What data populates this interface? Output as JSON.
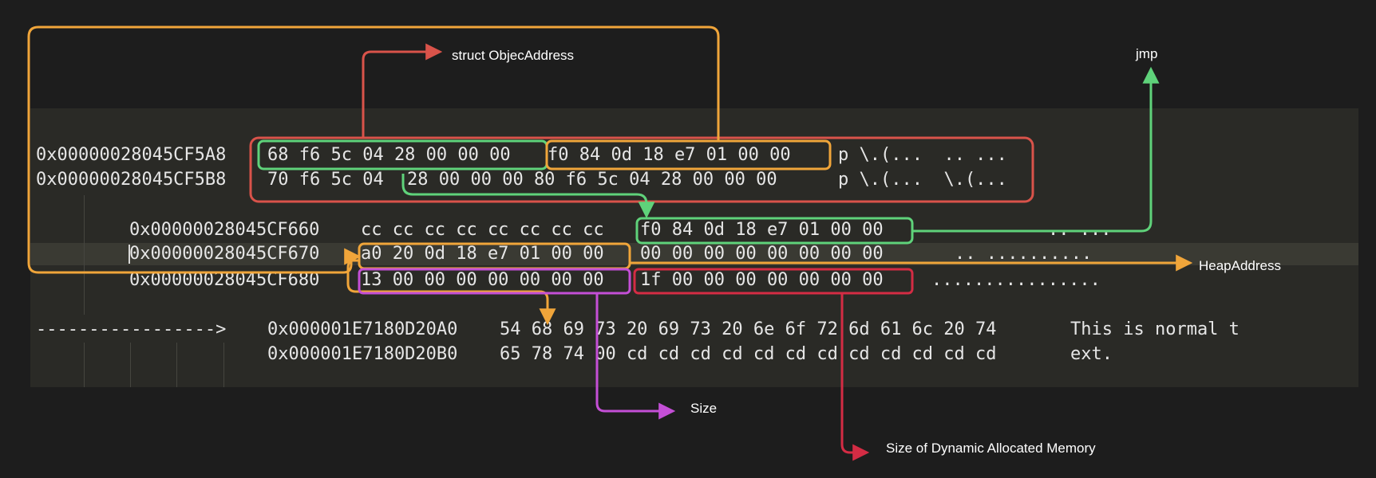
{
  "dump": {
    "row1": {
      "addr": "0x00000028045CF5A8",
      "g1": "68 f6 5c 04 28 00 00 00",
      "g2": "f0 84 0d 18 e7 01 00 00",
      "ascii": "p \\.(...  .. ..."
    },
    "row2": {
      "addr": "0x00000028045CF5B8",
      "g1": "70 f6 5c 04",
      "g2": "28 00 00 00 80 f6 5c 04 28 00 00 00",
      "ascii": "p \\.(...  \\.(..."
    },
    "row3": {
      "addr": "0x00000028045CF660",
      "g1": "cc cc cc cc cc cc cc cc",
      "g2": "f0 84 0d 18 e7 01 00 00",
      "ascii": ".. ..."
    },
    "row4": {
      "addr": "0x00000028045CF670",
      "g1": "a0 20 0d 18 e7 01 00 00",
      "g2": "00 00 00 00 00 00 00 00",
      "ascii": ".. .........."
    },
    "row5": {
      "addr": "0x00000028045CF680",
      "g1": "13 00 00 00 00 00 00 00",
      "g2": "1f 00 00 00 00 00 00 00",
      "ascii": "................"
    },
    "row6": {
      "lead": "----------------->",
      "addr": "0x000001E7180D20A0",
      "bytes": "54 68 69 73 20 69 73 20 6e 6f 72 6d 61 6c 20 74",
      "ascii": "This is normal t"
    },
    "row7": {
      "addr": "0x000001E7180D20B0",
      "bytes": "65 78 74 00 cd cd cd cd cd cd cd cd cd cd cd cd",
      "ascii": "ext."
    }
  },
  "labels": {
    "struct": "struct ObjecAddress",
    "jmp": "jmp",
    "heap": "HeapAddress",
    "size": "Size",
    "dyn": "Size of Dynamic Allocated Memory"
  },
  "colors": {
    "red": "#d9534a",
    "green": "#5fd27a",
    "orange": "#f0a53a",
    "purple": "#c44fd6",
    "crimson": "#d42c44",
    "text": "#e6e6e6",
    "panel": "#2a2a26"
  }
}
